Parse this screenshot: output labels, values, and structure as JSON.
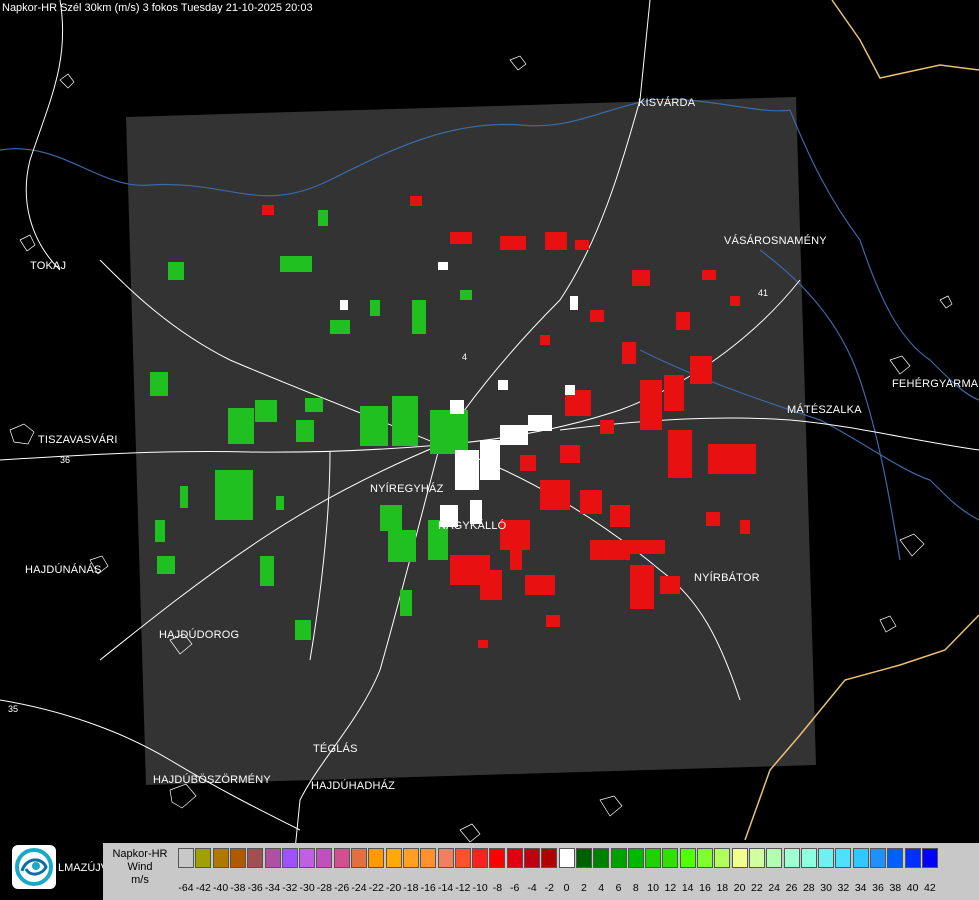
{
  "title": "Napkor-HR Szél 30km (m/s) 3 fokos Tuesday 21-10-2025 20:03",
  "cities": [
    {
      "name": "KISVÁRDA"
    },
    {
      "name": "VÁSÁROSNAMÉNY"
    },
    {
      "name": "TOKAJ"
    },
    {
      "name": "FEHÉRGYARMA"
    },
    {
      "name": "MÁTÉSZALKA"
    },
    {
      "name": "TISZAVASVÁRI"
    },
    {
      "name": "NYÍREGYHÁZ"
    },
    {
      "name": "NAGYKÁLLÓ"
    },
    {
      "name": "NYÍRBÁTOR"
    },
    {
      "name": "HAJDÚNÁNÁS"
    },
    {
      "name": "HAJDÚDOROG"
    },
    {
      "name": "TÉGLÁS"
    },
    {
      "name": "HAJDÚBÖSZÖRMÉNY"
    },
    {
      "name": "HAJDÚHADHÁZ"
    }
  ],
  "road_numbers": [
    "36",
    "4",
    "41",
    "35"
  ],
  "logo_text": "LMAZÚJVÁR",
  "legend": {
    "line1": "Napkor-HR",
    "line2": "Wind",
    "line3": "m/s",
    "ticks": [
      "-64",
      "-42",
      "-40",
      "-38",
      "-36",
      "-34",
      "-32",
      "-30",
      "-28",
      "-26",
      "-24",
      "-22",
      "-20",
      "-18",
      "-16",
      "-14",
      "-12",
      "-10",
      "-8",
      "-6",
      "-4",
      "-2",
      "0",
      "2",
      "4",
      "6",
      "8",
      "10",
      "12",
      "14",
      "16",
      "18",
      "20",
      "22",
      "24",
      "26",
      "28",
      "30",
      "32",
      "34",
      "36",
      "38",
      "40",
      "42"
    ],
    "colors": [
      "#c8c8c8",
      "#a0a000",
      "#b07800",
      "#b05a00",
      "#a05050",
      "#b050a0",
      "#a050ff",
      "#c060e0",
      "#c050c0",
      "#d05090",
      "#e07040",
      "#ff9900",
      "#ffaa00",
      "#ffa020",
      "#ff9030",
      "#f08060",
      "#ff5030",
      "#ff2020",
      "#ff0000",
      "#e00010",
      "#c00010",
      "#b00000",
      "#ffffff",
      "#006000",
      "#008000",
      "#00a000",
      "#00b800",
      "#20d000",
      "#30e000",
      "#50ff00",
      "#80ff30",
      "#b0ff60",
      "#f0ff90",
      "#d0ffa0",
      "#b0ffb0",
      "#a0ffd0",
      "#90ffe0",
      "#70f0f0",
      "#50e0ff",
      "#30c8ff",
      "#2090ff",
      "#0060ff",
      "#0030ff",
      "#0000ff"
    ]
  }
}
